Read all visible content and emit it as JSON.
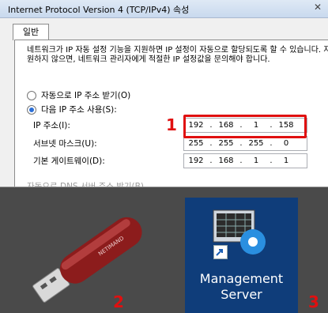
{
  "dialog": {
    "title": "Internet Protocol Version 4 (TCP/IPv4) 속성",
    "tab": "일반",
    "description": "네트워크가 IP 자동 설정 기능을 지원하면 IP 설정이 자동으로 할당되도록 할 수 있습니다. 지원하지 않으면, 네트워크 관리자에게 적절한 IP 설정값을 문의해야 합니다.",
    "radio_auto": "자동으로 IP 주소 받기(O)",
    "radio_manual": "다음 IP 주소 사용(S):",
    "ip_label": "IP 주소(I):",
    "subnet_label": "서브넷 마스크(U):",
    "gateway_label": "기본 게이트웨이(D):",
    "ip": [
      "192",
      "168",
      "1",
      "158"
    ],
    "subnet": [
      "255",
      "255",
      "255",
      "0"
    ],
    "gateway": [
      "192",
      "168",
      "1",
      "1"
    ],
    "dns_cut": "자동으로 DNS 서버 주소 받기(B)"
  },
  "callouts": {
    "one": "1",
    "two": "2",
    "three": "3"
  },
  "desktop_icon": {
    "label_line1": "Management",
    "label_line2": "Server"
  },
  "usb": {
    "brand": "NETIMAND"
  },
  "colors": {
    "highlight": "#e01010",
    "desktop_icon_bg": "#0f3d7a"
  }
}
